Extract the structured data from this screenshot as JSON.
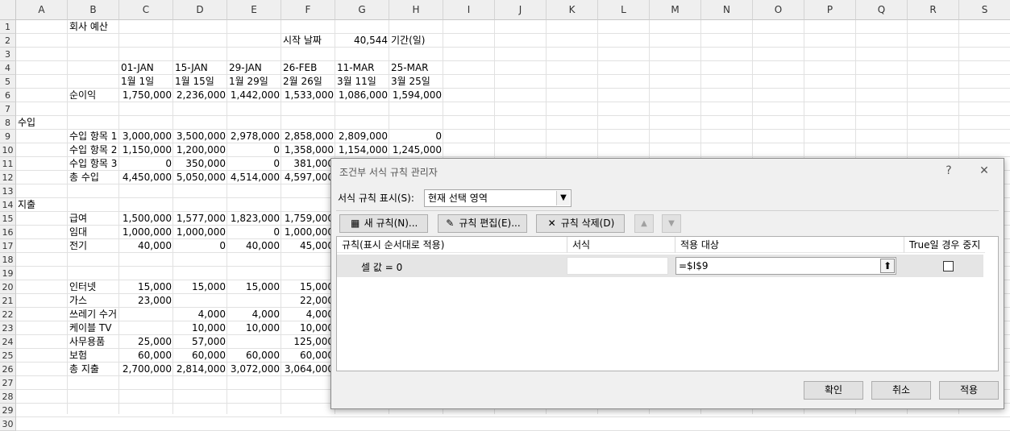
{
  "columns": [
    "A",
    "B",
    "C",
    "D",
    "E",
    "F",
    "G",
    "H",
    "I",
    "J",
    "K",
    "L",
    "M",
    "N",
    "O",
    "P",
    "Q",
    "R",
    "S"
  ],
  "rows": [
    "1",
    "2",
    "3",
    "4",
    "5",
    "6",
    "7",
    "8",
    "9",
    "10",
    "11",
    "12",
    "13",
    "14",
    "15",
    "16",
    "17",
    "18",
    "19",
    "20",
    "21",
    "22",
    "23",
    "24",
    "25",
    "26",
    "27",
    "28",
    "29",
    "30"
  ],
  "cells": [
    {
      "r": 1,
      "c": "B",
      "v": "회사 예산"
    },
    {
      "r": 2,
      "c": "F",
      "v": "시작 날짜"
    },
    {
      "r": 2,
      "c": "G",
      "v": "40,544",
      "num": true
    },
    {
      "r": 2,
      "c": "H",
      "v": "기간(일)"
    },
    {
      "r": 4,
      "c": "C",
      "v": "01-JAN"
    },
    {
      "r": 4,
      "c": "D",
      "v": "15-JAN"
    },
    {
      "r": 4,
      "c": "E",
      "v": "29-JAN"
    },
    {
      "r": 4,
      "c": "F",
      "v": "26-FEB"
    },
    {
      "r": 4,
      "c": "G",
      "v": "11-MAR"
    },
    {
      "r": 4,
      "c": "H",
      "v": "25-MAR"
    },
    {
      "r": 5,
      "c": "C",
      "v": "1월 1일"
    },
    {
      "r": 5,
      "c": "D",
      "v": "1월 15일"
    },
    {
      "r": 5,
      "c": "E",
      "v": "1월 29일"
    },
    {
      "r": 5,
      "c": "F",
      "v": "2월 26일"
    },
    {
      "r": 5,
      "c": "G",
      "v": "3월 11일"
    },
    {
      "r": 5,
      "c": "H",
      "v": "3월 25일"
    },
    {
      "r": 6,
      "c": "B",
      "v": "순이익"
    },
    {
      "r": 6,
      "c": "C",
      "v": "1,750,000",
      "num": true
    },
    {
      "r": 6,
      "c": "D",
      "v": "2,236,000",
      "num": true
    },
    {
      "r": 6,
      "c": "E",
      "v": "1,442,000",
      "num": true
    },
    {
      "r": 6,
      "c": "F",
      "v": "1,533,000",
      "num": true
    },
    {
      "r": 6,
      "c": "G",
      "v": "1,086,000",
      "num": true
    },
    {
      "r": 6,
      "c": "H",
      "v": "1,594,000",
      "num": true
    },
    {
      "r": 8,
      "c": "A",
      "v": "수입"
    },
    {
      "r": 9,
      "c": "B",
      "v": "수입 항목 1"
    },
    {
      "r": 9,
      "c": "C",
      "v": "3,000,000",
      "num": true
    },
    {
      "r": 9,
      "c": "D",
      "v": "3,500,000",
      "num": true
    },
    {
      "r": 9,
      "c": "E",
      "v": "2,978,000",
      "num": true
    },
    {
      "r": 9,
      "c": "F",
      "v": "2,858,000",
      "num": true
    },
    {
      "r": 9,
      "c": "G",
      "v": "2,809,000",
      "num": true
    },
    {
      "r": 9,
      "c": "H",
      "v": "0",
      "num": true
    },
    {
      "r": 10,
      "c": "B",
      "v": "수입 항목 2"
    },
    {
      "r": 10,
      "c": "C",
      "v": "1,150,000",
      "num": true
    },
    {
      "r": 10,
      "c": "D",
      "v": "1,200,000",
      "num": true
    },
    {
      "r": 10,
      "c": "E",
      "v": "0",
      "num": true
    },
    {
      "r": 10,
      "c": "F",
      "v": "1,358,000",
      "num": true
    },
    {
      "r": 10,
      "c": "G",
      "v": "1,154,000",
      "num": true
    },
    {
      "r": 10,
      "c": "H",
      "v": "1,245,000",
      "num": true
    },
    {
      "r": 11,
      "c": "B",
      "v": "수입 항목 3"
    },
    {
      "r": 11,
      "c": "C",
      "v": "0",
      "num": true
    },
    {
      "r": 11,
      "c": "D",
      "v": "350,000",
      "num": true
    },
    {
      "r": 11,
      "c": "E",
      "v": "0",
      "num": true
    },
    {
      "r": 11,
      "c": "F",
      "v": "381,000",
      "num": true
    },
    {
      "r": 12,
      "c": "B",
      "v": "총 수입"
    },
    {
      "r": 12,
      "c": "C",
      "v": "4,450,000",
      "num": true
    },
    {
      "r": 12,
      "c": "D",
      "v": "5,050,000",
      "num": true
    },
    {
      "r": 12,
      "c": "E",
      "v": "4,514,000",
      "num": true
    },
    {
      "r": 12,
      "c": "F",
      "v": "4,597,000",
      "num": true
    },
    {
      "r": 14,
      "c": "A",
      "v": "지출"
    },
    {
      "r": 15,
      "c": "B",
      "v": "급여"
    },
    {
      "r": 15,
      "c": "C",
      "v": "1,500,000",
      "num": true
    },
    {
      "r": 15,
      "c": "D",
      "v": "1,577,000",
      "num": true
    },
    {
      "r": 15,
      "c": "E",
      "v": "1,823,000",
      "num": true
    },
    {
      "r": 15,
      "c": "F",
      "v": "1,759,000",
      "num": true
    },
    {
      "r": 16,
      "c": "B",
      "v": "임대"
    },
    {
      "r": 16,
      "c": "C",
      "v": "1,000,000",
      "num": true
    },
    {
      "r": 16,
      "c": "D",
      "v": "1,000,000",
      "num": true
    },
    {
      "r": 16,
      "c": "E",
      "v": "0",
      "num": true
    },
    {
      "r": 16,
      "c": "F",
      "v": "1,000,000",
      "num": true
    },
    {
      "r": 17,
      "c": "B",
      "v": "전기"
    },
    {
      "r": 17,
      "c": "C",
      "v": "40,000",
      "num": true
    },
    {
      "r": 17,
      "c": "D",
      "v": "0",
      "num": true
    },
    {
      "r": 17,
      "c": "E",
      "v": "40,000",
      "num": true
    },
    {
      "r": 17,
      "c": "F",
      "v": "45,000",
      "num": true
    },
    {
      "r": 20,
      "c": "B",
      "v": "인터넷"
    },
    {
      "r": 20,
      "c": "C",
      "v": "15,000",
      "num": true
    },
    {
      "r": 20,
      "c": "D",
      "v": "15,000",
      "num": true
    },
    {
      "r": 20,
      "c": "E",
      "v": "15,000",
      "num": true
    },
    {
      "r": 20,
      "c": "F",
      "v": "15,000",
      "num": true
    },
    {
      "r": 21,
      "c": "B",
      "v": "가스"
    },
    {
      "r": 21,
      "c": "C",
      "v": "23,000",
      "num": true
    },
    {
      "r": 21,
      "c": "F",
      "v": "22,000",
      "num": true
    },
    {
      "r": 22,
      "c": "B",
      "v": "쓰레기 수거"
    },
    {
      "r": 22,
      "c": "D",
      "v": "4,000",
      "num": true
    },
    {
      "r": 22,
      "c": "E",
      "v": "4,000",
      "num": true
    },
    {
      "r": 22,
      "c": "F",
      "v": "4,000",
      "num": true
    },
    {
      "r": 23,
      "c": "B",
      "v": "케이블 TV"
    },
    {
      "r": 23,
      "c": "D",
      "v": "10,000",
      "num": true
    },
    {
      "r": 23,
      "c": "E",
      "v": "10,000",
      "num": true
    },
    {
      "r": 23,
      "c": "F",
      "v": "10,000",
      "num": true
    },
    {
      "r": 24,
      "c": "B",
      "v": "사무용품"
    },
    {
      "r": 24,
      "c": "C",
      "v": "25,000",
      "num": true
    },
    {
      "r": 24,
      "c": "D",
      "v": "57,000",
      "num": true
    },
    {
      "r": 24,
      "c": "F",
      "v": "125,000",
      "num": true
    },
    {
      "r": 25,
      "c": "B",
      "v": "보험"
    },
    {
      "r": 25,
      "c": "C",
      "v": "60,000",
      "num": true
    },
    {
      "r": 25,
      "c": "D",
      "v": "60,000",
      "num": true
    },
    {
      "r": 25,
      "c": "E",
      "v": "60,000",
      "num": true
    },
    {
      "r": 25,
      "c": "F",
      "v": "60,000",
      "num": true
    },
    {
      "r": 26,
      "c": "B",
      "v": "총 지출"
    },
    {
      "r": 26,
      "c": "C",
      "v": "2,700,000",
      "num": true
    },
    {
      "r": 26,
      "c": "D",
      "v": "2,814,000",
      "num": true
    },
    {
      "r": 26,
      "c": "E",
      "v": "3,072,000",
      "num": true
    },
    {
      "r": 26,
      "c": "F",
      "v": "3,064,000",
      "num": true
    }
  ],
  "dialog": {
    "title": "조건부 서식 규칙 관리자",
    "help": "?",
    "close": "✕",
    "show_label": "서식 규칙 표시(S):",
    "show_value": "현재 선택 영역",
    "new_rule": "새 규칙(N)...",
    "edit_rule": "규칙 편집(E)...",
    "delete_rule": "규칙 삭제(D)",
    "move_up": "▲",
    "move_down": "▼",
    "headers": {
      "rule": "규칙(표시 순서대로 적용)",
      "format": "서식",
      "applies": "적용 대상",
      "stop": "True일 경우 중지"
    },
    "rule": {
      "description": "셀 값 = 0",
      "applies_to": "=$I$9"
    },
    "ok": "확인",
    "cancel": "취소",
    "apply": "적용"
  }
}
